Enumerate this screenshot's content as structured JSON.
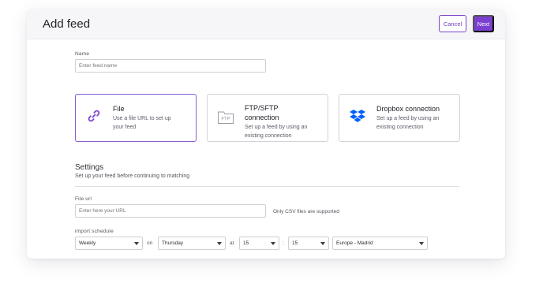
{
  "header": {
    "title": "Add feed",
    "cancel_label": "Cancel",
    "next_label": "Next"
  },
  "name": {
    "label": "Name",
    "placeholder": "Enter feed name"
  },
  "options": [
    {
      "title": "File",
      "desc1": "Use a file URL to set up",
      "desc2": "your feed",
      "icon": "link-icon",
      "selected": true
    },
    {
      "title1": "FTP/SFTP",
      "title2": "connection",
      "desc1": "Set up a feed by using an",
      "desc2": "existing connection",
      "icon": "ftp-icon",
      "icon_text": "FTP",
      "selected": false
    },
    {
      "title": "Dropbox connection",
      "desc1": "Set up a feed by using an",
      "desc2": "existing connection",
      "icon": "dropbox-icon",
      "selected": false
    }
  ],
  "settings": {
    "title": "Settings",
    "subtitle": "Set up your feed before continuing to matching"
  },
  "file_url": {
    "label": "File url",
    "placeholder": "Enter here your URL",
    "hint": "Only CSV files are supported"
  },
  "schedule": {
    "label": "import schedule",
    "frequency": "Weekly",
    "on_label": "on",
    "day": "Thursday",
    "at_label": "at",
    "hour": "15",
    "colon": ":",
    "minute": "15",
    "timezone": "Europe - Madrid"
  },
  "colors": {
    "accent": "#7b3fd0",
    "dropbox": "#0061fe"
  }
}
